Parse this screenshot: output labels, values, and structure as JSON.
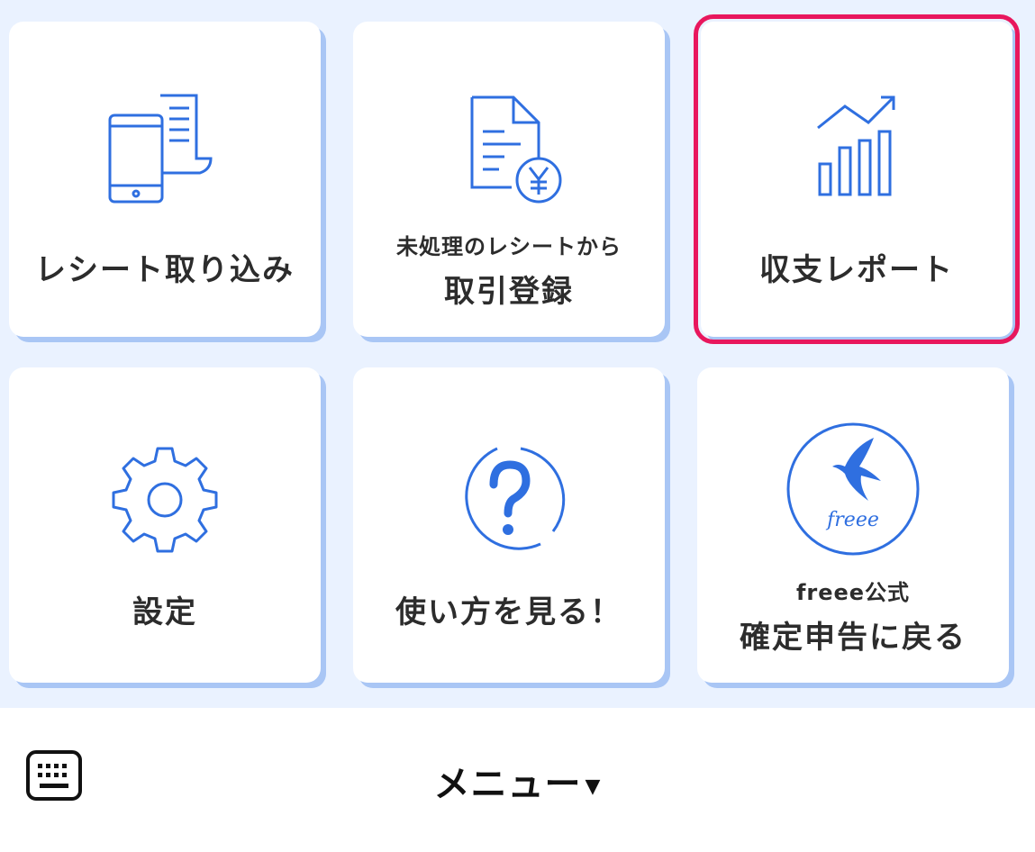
{
  "colors": {
    "background": "#eaf2ff",
    "icon_blue": "#2f6fe0",
    "shadow": "#a9c6f5",
    "highlight": "#e8175d"
  },
  "tiles": [
    {
      "id": "receipt-import",
      "icon": "receipt-phone-icon",
      "label": "レシート取り込み"
    },
    {
      "id": "transaction-register",
      "icon": "document-yen-icon",
      "label_top": "未処理のレシートから",
      "label_bottom": "取引登録"
    },
    {
      "id": "income-report",
      "icon": "chart-growth-icon",
      "label": "収支レポート",
      "highlighted": true
    },
    {
      "id": "settings",
      "icon": "gear-icon",
      "label": "設定"
    },
    {
      "id": "how-to",
      "icon": "question-icon",
      "label": "使い方を見る！"
    },
    {
      "id": "freee-return",
      "icon": "freee-logo-icon",
      "logo_text": "freee",
      "label_top": "freee公式",
      "label_bottom": "確定申告に戻る"
    }
  ],
  "bottom_bar": {
    "menu_label": "メニュー",
    "caret": "▼",
    "keyboard_icon": "keyboard-icon"
  }
}
